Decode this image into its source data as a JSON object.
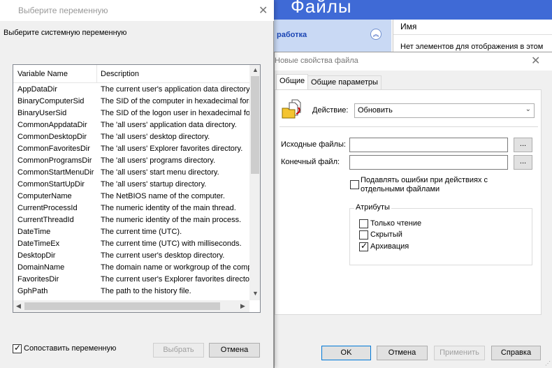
{
  "background_app": {
    "title": "Файлы",
    "nav_item": "работка",
    "collapse_icon": "chevron-up-double",
    "list_column_header": "Имя",
    "list_empty_text": "Нет элементов для отображения в этом"
  },
  "variable_dialog": {
    "title": "Выберите переменную",
    "prompt": "Выберите системную переменную",
    "columns": [
      "Variable Name",
      "Description"
    ],
    "rows": [
      {
        "name": "AppDataDir",
        "description": "The current user's application data directory."
      },
      {
        "name": "BinaryComputerSid",
        "description": "The SID of the computer in hexadecimal format."
      },
      {
        "name": "BinaryUserSid",
        "description": "The SID of the logon user in hexadecimal format."
      },
      {
        "name": "CommonAppdataDir",
        "description": "The 'all users' application data directory."
      },
      {
        "name": "CommonDesktopDir",
        "description": "The 'all users' desktop directory."
      },
      {
        "name": "CommonFavoritesDir",
        "description": "The 'all users' Explorer favorites directory."
      },
      {
        "name": "CommonProgramsDir",
        "description": "The 'all users' programs directory."
      },
      {
        "name": "CommonStartMenuDir",
        "description": "The 'all users' start menu directory."
      },
      {
        "name": "CommonStartUpDir",
        "description": "The 'all users' startup directory."
      },
      {
        "name": "ComputerName",
        "description": "The NetBIOS name of the computer."
      },
      {
        "name": "CurrentProcessId",
        "description": "The numeric identity of the main thread."
      },
      {
        "name": "CurrentThreadId",
        "description": "The numeric identity of the main process."
      },
      {
        "name": "DateTime",
        "description": "The current time (UTC)."
      },
      {
        "name": "DateTimeEx",
        "description": "The current time (UTC) with milliseconds."
      },
      {
        "name": "DesktopDir",
        "description": "The current user's desktop directory."
      },
      {
        "name": "DomainName",
        "description": "The domain name or workgroup of the computer."
      },
      {
        "name": "FavoritesDir",
        "description": "The current user's Explorer favorites directory."
      },
      {
        "name": "GphPath",
        "description": "The path to the history file."
      }
    ],
    "match_checkbox": {
      "label": "Сопоставить переменную",
      "checked": true
    },
    "select_button": "Выбрать",
    "cancel_button": "Отмена"
  },
  "properties_dialog": {
    "title": "Новые свойства файла",
    "tabs": [
      "Общие",
      "Общие параметры"
    ],
    "active_tab": 0,
    "action_label": "Действие:",
    "action_value": "Обновить",
    "source_label": "Исходные файлы:",
    "source_value": "",
    "target_label": "Конечный файл:",
    "target_value": "",
    "browse_label": "...",
    "suppress_errors": {
      "label_line1": "Подавлять ошибки при действиях с",
      "label_line2": "отдельными файлами",
      "checked": false
    },
    "attributes": {
      "title": "Атрибуты",
      "items": [
        {
          "label": "Только чтение",
          "checked": false
        },
        {
          "label": "Скрытый",
          "checked": false
        },
        {
          "label": "Архивация",
          "checked": true
        }
      ]
    },
    "buttons": {
      "ok": "OK",
      "cancel": "Отмена",
      "apply": "Применить",
      "help": "Справка"
    }
  }
}
